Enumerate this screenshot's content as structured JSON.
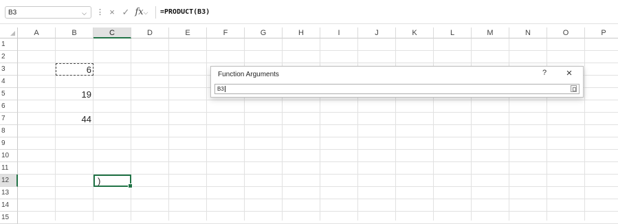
{
  "formula_bar": {
    "name_box": "B3",
    "formula": "=PRODUCT(B3)",
    "cancel_icon": "×",
    "enter_icon": "✓",
    "fx_label": "fx"
  },
  "columns": [
    "A",
    "B",
    "C",
    "D",
    "E",
    "F",
    "G",
    "H",
    "I",
    "J",
    "K",
    "L",
    "M",
    "N",
    "O",
    "P"
  ],
  "rows": [
    "1",
    "2",
    "3",
    "4",
    "5",
    "6",
    "7",
    "8",
    "9",
    "10",
    "11",
    "12",
    "13",
    "14",
    "15"
  ],
  "cells": {
    "B3": "6",
    "B5": "19",
    "B7": "44",
    "C12": ")"
  },
  "dialog": {
    "title": "Function Arguments",
    "help": "?",
    "close": "×",
    "input_value": "B3"
  },
  "colors": {
    "accent": "#217346",
    "gridline": "#e1e1e1"
  }
}
